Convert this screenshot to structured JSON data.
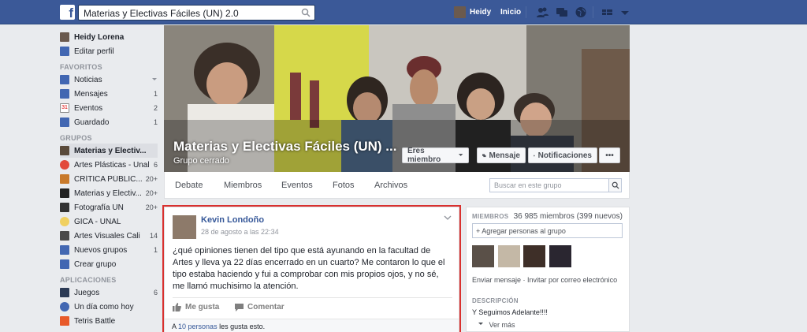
{
  "topbar": {
    "logo": "f",
    "search_value": "Materias y Electivas Fáciles (UN) 2.0",
    "user_name": "Heidy",
    "home_label": "Inicio"
  },
  "sidebar": {
    "profile_name": "Heidy Lorena",
    "edit_profile": "Editar perfil",
    "favorites_header": "FAVORITOS",
    "favorites": [
      {
        "label": "Noticias",
        "count": ""
      },
      {
        "label": "Mensajes",
        "count": "1"
      },
      {
        "label": "Eventos",
        "count": "2"
      },
      {
        "label": "Guardado",
        "count": "1"
      }
    ],
    "groups_header": "GRUPOS",
    "groups": [
      {
        "label": "Materias y Electiv...",
        "count": ""
      },
      {
        "label": "Artes Plásticas - Unal",
        "count": "6"
      },
      {
        "label": "CRÍTICA PÚBLIC...",
        "count": "20+"
      },
      {
        "label": "Materias y Electiv...",
        "count": "20+"
      },
      {
        "label": "Fotografía UN",
        "count": "20+"
      },
      {
        "label": "GICA - UNAL",
        "count": ""
      },
      {
        "label": "Artes Visuales Cali",
        "count": "14"
      },
      {
        "label": "Nuevos grupos",
        "count": "1"
      },
      {
        "label": "Crear grupo",
        "count": ""
      }
    ],
    "apps_header": "APLICACIONES",
    "apps": [
      {
        "label": "Juegos",
        "count": "6"
      },
      {
        "label": "Un día como hoy",
        "count": ""
      },
      {
        "label": "Tetris Battle",
        "count": ""
      }
    ]
  },
  "cover": {
    "title": "Materias y Electivas Fáciles (UN) ...",
    "subtitle": "Grupo cerrado",
    "member_button": "Eres miembro",
    "message_button": "Mensaje",
    "notifications_button": "Notificaciones",
    "more_button": "•••"
  },
  "tabs": {
    "items": [
      "Debate",
      "Miembros",
      "Eventos",
      "Fotos",
      "Archivos"
    ],
    "search_placeholder": "Buscar en este grupo"
  },
  "post": {
    "author": "Kevin Londoño",
    "date": "28 de agosto a las 22:34",
    "text": "¿qué opiniones tienen del tipo que está ayunando en la facultad de Artes y lleva ya 22 días encerrado en un cuarto? Me contaron lo que el tipo estaba haciendo y fui a comprobar con mis propios ojos, y no sé, me llamó muchisimo la atención.",
    "like_label": "Me gusta",
    "comment_label": "Comentar",
    "likes_prefix": "A",
    "likes_link": "10 personas",
    "likes_suffix": "les gusta esto."
  },
  "right": {
    "members_header": "MIEMBROS",
    "members_count": "36 985 miembros (399 nuevos)",
    "add_people": "+ Agregar personas al grupo",
    "links": "Enviar mensaje · Invitar por correo electrónico",
    "desc_header": "DESCRIPCIÓN",
    "desc_text": "Y Seguimos Adelante!!!!",
    "see_more": "Ver más"
  },
  "colors": {
    "topbar": "#3b5998",
    "link": "#365899",
    "highlight": "#d9312f"
  }
}
